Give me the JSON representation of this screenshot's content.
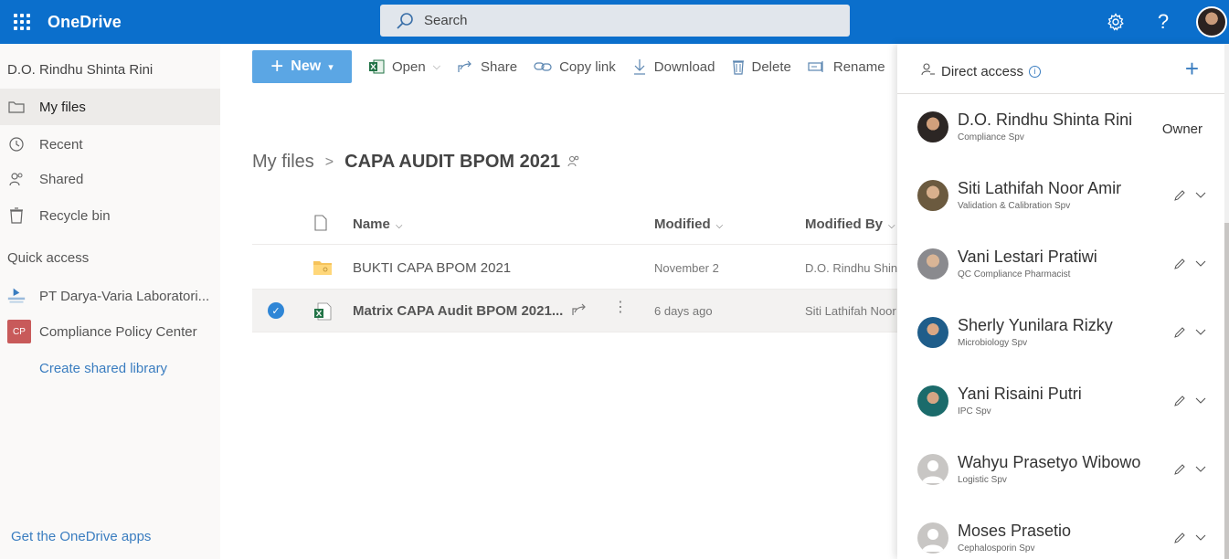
{
  "topbar": {
    "app_name": "OneDrive",
    "search_placeholder": "Search",
    "settings_icon": "gear-icon",
    "help_label": "?"
  },
  "sidebar": {
    "user_name": "D.O. Rindhu Shinta Rini",
    "nav": [
      {
        "label": "My files",
        "icon": "folder-icon",
        "selected": true
      },
      {
        "label": "Recent",
        "icon": "clock-icon",
        "selected": false
      },
      {
        "label": "Shared",
        "icon": "people-icon",
        "selected": false
      },
      {
        "label": "Recycle bin",
        "icon": "recycle-bin-icon",
        "selected": false
      }
    ],
    "quick_access_title": "Quick access",
    "quick_access": [
      {
        "label": "PT Darya-Varia Laboratori...",
        "icon": "darya-varia-logo"
      },
      {
        "label": "Compliance Policy Center",
        "icon": "cp-badge",
        "badge": "CP"
      }
    ],
    "create_library": "Create shared library",
    "get_apps": "Get the OneDrive apps"
  },
  "commands": {
    "new": "New",
    "open": "Open",
    "share": "Share",
    "copy_link": "Copy link",
    "download": "Download",
    "delete": "Delete",
    "rename": "Rename"
  },
  "breadcrumb": {
    "root": "My files",
    "separator": ">",
    "current": "CAPA AUDIT BPOM 2021"
  },
  "list": {
    "columns": {
      "name": "Name",
      "modified": "Modified",
      "modified_by": "Modified By"
    },
    "rows": [
      {
        "name": "BUKTI CAPA BPOM 2021",
        "type": "folder",
        "modified": "November 2",
        "modified_by": "D.O. Rindhu Shint",
        "selected": false
      },
      {
        "name": "Matrix CAPA Audit BPOM 2021...",
        "type": "excel",
        "modified": "6 days ago",
        "modified_by": "Siti Lathifah Noor",
        "selected": true
      }
    ]
  },
  "panel": {
    "title": "Direct access",
    "people": [
      {
        "name": "D.O. Rindhu Shinta Rini",
        "role": "Compliance Spv",
        "permission": "Owner",
        "avatar": "photo"
      },
      {
        "name": "Siti Lathifah Noor Amir",
        "role": "Validation & Calibration Spv",
        "permission": "",
        "avatar": "photo"
      },
      {
        "name": "Vani Lestari Pratiwi",
        "role": "QC Compliance Pharmacist",
        "permission": "",
        "avatar": "photo"
      },
      {
        "name": "Sherly Yunilara Rizky",
        "role": "Microbiology Spv",
        "permission": "",
        "avatar": "photo"
      },
      {
        "name": "Yani Risaini Putri",
        "role": "IPC Spv",
        "permission": "",
        "avatar": "photo"
      },
      {
        "name": "Wahyu Prasetyo Wibowo",
        "role": "Logistic Spv",
        "permission": "",
        "avatar": "placeholder"
      },
      {
        "name": "Moses Prasetio",
        "role": "Cephalosporin Spv",
        "permission": "",
        "avatar": "placeholder"
      }
    ]
  },
  "colors": {
    "topbar": "#0b6fcc",
    "accent": "#3a7dc0",
    "new_button": "#5ba6e4"
  }
}
